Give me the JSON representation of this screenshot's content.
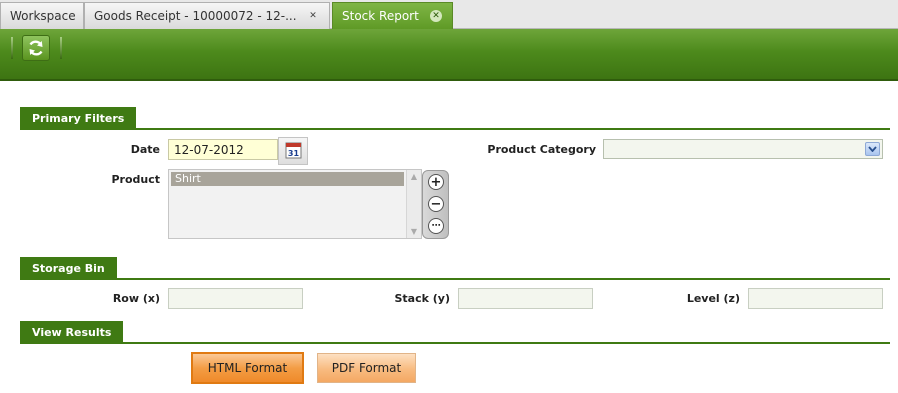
{
  "tabs": [
    {
      "label": "Workspace",
      "closable": false,
      "active": false
    },
    {
      "label": "Goods Receipt - 10000072 - 12-...",
      "closable": true,
      "active": false
    },
    {
      "label": "Stock Report",
      "closable": true,
      "active": true
    }
  ],
  "toolbar": {
    "refresh_icon": "refresh-icon"
  },
  "sections": {
    "primary_filters": "Primary Filters",
    "storage_bin": "Storage Bin",
    "view_results": "View Results"
  },
  "filters": {
    "date_label": "Date",
    "date_value": "12-07-2012",
    "calendar_day": "31",
    "product_category_label": "Product Category",
    "product_category_value": "",
    "product_label": "Product",
    "product_items": [
      "Shirt"
    ]
  },
  "storage_bin": {
    "row_label": "Row (x)",
    "row_value": "",
    "stack_label": "Stack (y)",
    "stack_value": "",
    "level_label": "Level (z)",
    "level_value": ""
  },
  "results": {
    "html_button": "HTML Format",
    "pdf_button": "PDF Format"
  },
  "colors": {
    "brand_green": "#3f7a13",
    "button_orange": "#f39d45"
  }
}
